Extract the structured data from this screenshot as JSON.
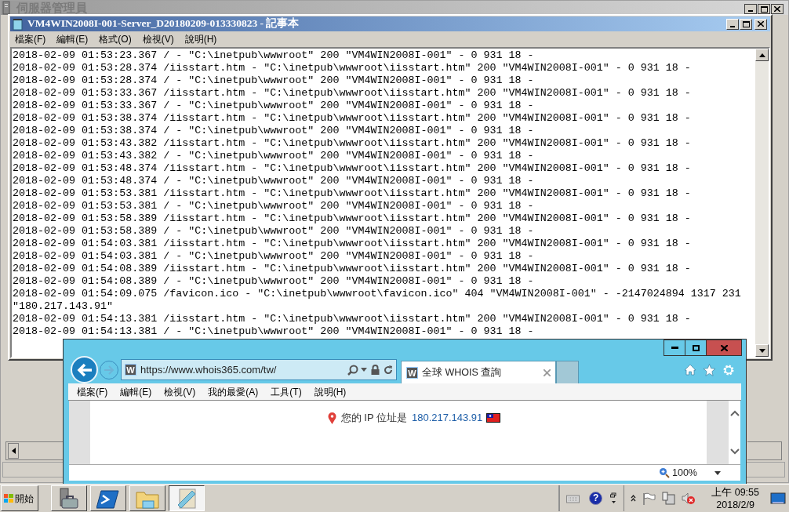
{
  "server_manager": {
    "title": "伺服器管理員"
  },
  "notepad": {
    "title": "VM4WIN2008I-001-Server_D20180209-013330823 - 記事本",
    "menu": [
      "檔案(F)",
      "編輯(E)",
      "格式(O)",
      "檢視(V)",
      "說明(H)"
    ],
    "lines": [
      "2018-02-09 01:53:23.367 / - \"C:\\inetpub\\wwwroot\" 200 \"VM4WIN2008I-001\" - 0 931 18 -",
      "2018-02-09 01:53:28.374 /iisstart.htm - \"C:\\inetpub\\wwwroot\\iisstart.htm\" 200 \"VM4WIN2008I-001\" - 0 931 18 -",
      "2018-02-09 01:53:28.374 / - \"C:\\inetpub\\wwwroot\" 200 \"VM4WIN2008I-001\" - 0 931 18 -",
      "2018-02-09 01:53:33.367 /iisstart.htm - \"C:\\inetpub\\wwwroot\\iisstart.htm\" 200 \"VM4WIN2008I-001\" - 0 931 18 -",
      "2018-02-09 01:53:33.367 / - \"C:\\inetpub\\wwwroot\" 200 \"VM4WIN2008I-001\" - 0 931 18 -",
      "2018-02-09 01:53:38.374 /iisstart.htm - \"C:\\inetpub\\wwwroot\\iisstart.htm\" 200 \"VM4WIN2008I-001\" - 0 931 18 -",
      "2018-02-09 01:53:38.374 / - \"C:\\inetpub\\wwwroot\" 200 \"VM4WIN2008I-001\" - 0 931 18 -",
      "2018-02-09 01:53:43.382 /iisstart.htm - \"C:\\inetpub\\wwwroot\\iisstart.htm\" 200 \"VM4WIN2008I-001\" - 0 931 18 -",
      "2018-02-09 01:53:43.382 / - \"C:\\inetpub\\wwwroot\" 200 \"VM4WIN2008I-001\" - 0 931 18 -",
      "2018-02-09 01:53:48.374 /iisstart.htm - \"C:\\inetpub\\wwwroot\\iisstart.htm\" 200 \"VM4WIN2008I-001\" - 0 931 18 -",
      "2018-02-09 01:53:48.374 / - \"C:\\inetpub\\wwwroot\" 200 \"VM4WIN2008I-001\" - 0 931 18 -",
      "2018-02-09 01:53:53.381 /iisstart.htm - \"C:\\inetpub\\wwwroot\\iisstart.htm\" 200 \"VM4WIN2008I-001\" - 0 931 18 -",
      "2018-02-09 01:53:53.381 / - \"C:\\inetpub\\wwwroot\" 200 \"VM4WIN2008I-001\" - 0 931 18 -",
      "2018-02-09 01:53:58.389 /iisstart.htm - \"C:\\inetpub\\wwwroot\\iisstart.htm\" 200 \"VM4WIN2008I-001\" - 0 931 18 -",
      "2018-02-09 01:53:58.389 / - \"C:\\inetpub\\wwwroot\" 200 \"VM4WIN2008I-001\" - 0 931 18 -",
      "2018-02-09 01:54:03.381 /iisstart.htm - \"C:\\inetpub\\wwwroot\\iisstart.htm\" 200 \"VM4WIN2008I-001\" - 0 931 18 -",
      "2018-02-09 01:54:03.381 / - \"C:\\inetpub\\wwwroot\" 200 \"VM4WIN2008I-001\" - 0 931 18 -",
      "2018-02-09 01:54:08.389 /iisstart.htm - \"C:\\inetpub\\wwwroot\\iisstart.htm\" 200 \"VM4WIN2008I-001\" - 0 931 18 -",
      "2018-02-09 01:54:08.389 / - \"C:\\inetpub\\wwwroot\" 200 \"VM4WIN2008I-001\" - 0 931 18 -",
      "2018-02-09 01:54:09.075 /favicon.ico - \"C:\\inetpub\\wwwroot\\favicon.ico\" 404 \"VM4WIN2008I-001\" - -2147024894 1317 231 \"180.217.143.91\"",
      "2018-02-09 01:54:13.381 /iisstart.htm - \"C:\\inetpub\\wwwroot\\iisstart.htm\" 200 \"VM4WIN2008I-001\" - 0 931 18 -",
      "2018-02-09 01:54:13.381 / - \"C:\\inetpub\\wwwroot\" 200 \"VM4WIN2008I-001\" - 0 931 18 -"
    ]
  },
  "browser": {
    "address": {
      "icon_letter": "W",
      "url": "https://www.whois365.com/tw/"
    },
    "tabs": [
      {
        "icon_letter": "W",
        "title": "全球 WHOIS 查詢",
        "selected": true
      }
    ],
    "menu": [
      "檔案(F)",
      "編輯(E)",
      "檢視(V)",
      "我的最愛(A)",
      "工具(T)",
      "說明(H)"
    ],
    "message": {
      "label": "您的 IP 位址是",
      "ip": "180.217.143.91"
    },
    "zoom": "100%"
  },
  "taskbar": {
    "start": "開始",
    "apps": [
      {
        "kind": "server-manager",
        "selected": false
      },
      {
        "kind": "powershell",
        "selected": false
      },
      {
        "kind": "explorer",
        "selected": false
      },
      {
        "kind": "notepad",
        "selected": true
      }
    ],
    "help_glyph": "?",
    "clock": {
      "time": "上午 09:55",
      "date": "2018/2/9"
    }
  }
}
